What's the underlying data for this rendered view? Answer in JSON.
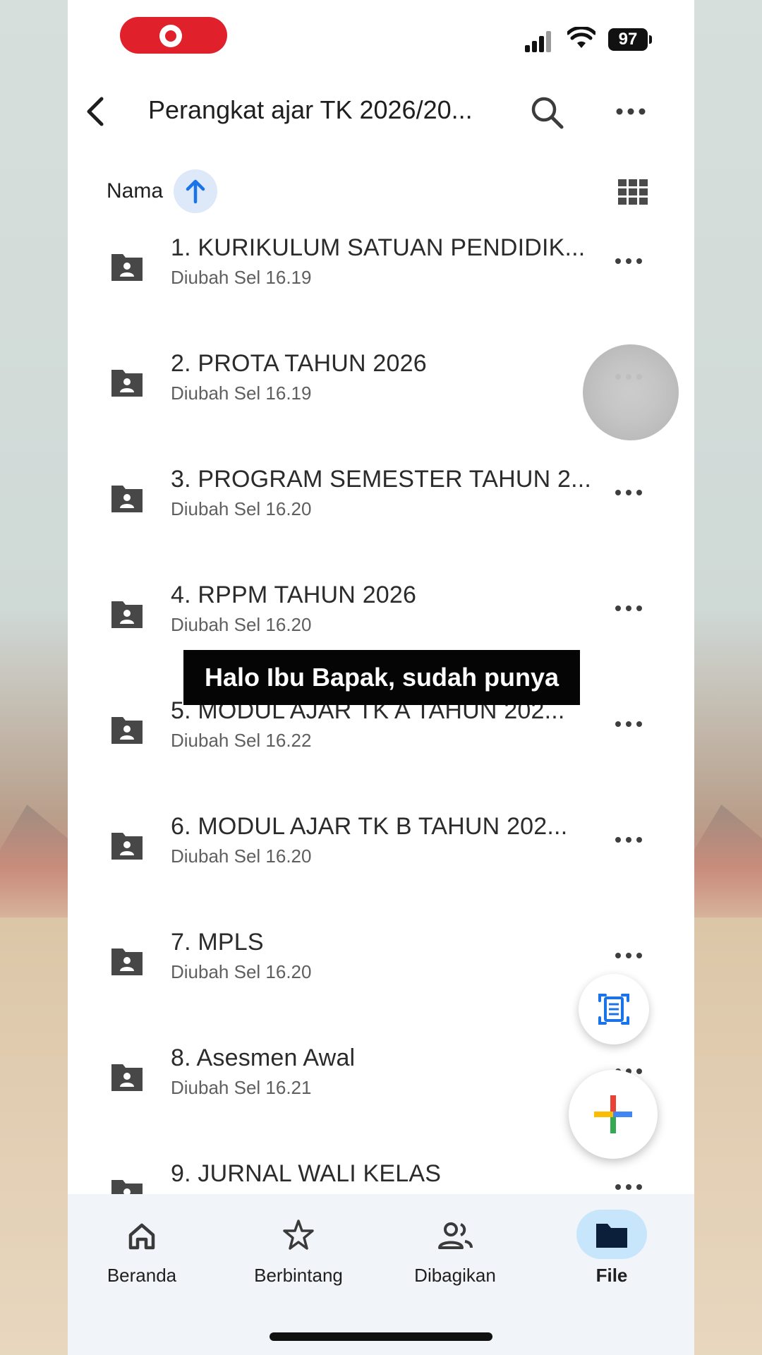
{
  "status_bar": {
    "battery": "97"
  },
  "app_bar": {
    "title": "Perangkat ajar TK 2026/20..."
  },
  "sort": {
    "label": "Nama"
  },
  "files": [
    {
      "name": "1. KURIKULUM SATUAN PENDIDIK...",
      "modified": "Diubah Sel 16.19"
    },
    {
      "name": "2. PROTA TAHUN 2026",
      "modified": "Diubah Sel 16.19"
    },
    {
      "name": "3. PROGRAM SEMESTER TAHUN 2...",
      "modified": "Diubah Sel 16.20"
    },
    {
      "name": "4. RPPM TAHUN 2026",
      "modified": "Diubah Sel 16.20"
    },
    {
      "name": "5. MODUL AJAR TK A TAHUN 202...",
      "modified": "Diubah Sel 16.22"
    },
    {
      "name": "6. MODUL  AJAR TK B TAHUN 202...",
      "modified": "Diubah Sel 16.20"
    },
    {
      "name": "7. MPLS",
      "modified": "Diubah Sel 16.20"
    },
    {
      "name": "8. Asesmen Awal",
      "modified": "Diubah Sel 16.21"
    },
    {
      "name": "9. JURNAL WALI KELAS",
      "modified": ""
    }
  ],
  "caption": "Halo Ibu Bapak, sudah punya",
  "bottom_nav": [
    {
      "label": "Beranda",
      "icon": "home-icon"
    },
    {
      "label": "Berbintang",
      "icon": "star-icon"
    },
    {
      "label": "Dibagikan",
      "icon": "people-icon"
    },
    {
      "label": "File",
      "icon": "folder-icon",
      "active": true
    }
  ],
  "colors": {
    "accent": "#1a73e8",
    "active_nav": "#c7e6fb",
    "record": "#e0202a"
  }
}
